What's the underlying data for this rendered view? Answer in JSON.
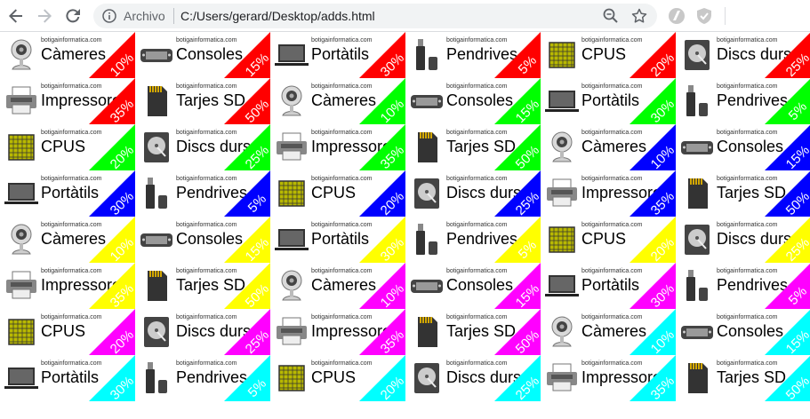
{
  "browser": {
    "secure_label": "Archivo",
    "url": "C:/Users/gerard/Desktop/adds.html"
  },
  "site": "botigainformatica.com",
  "icons": [
    "camera-icon",
    "gamepad-icon",
    "laptop-icon",
    "usb-drive-icon",
    "cpu-chip-icon",
    "hard-disk-icon",
    "printer-icon",
    "sd-card-icon"
  ],
  "colors": [
    "#ff0000",
    "#00ff00",
    "#0000ff",
    "#ffff00",
    "#ff00ff",
    "#00ffff"
  ],
  "ads": [
    {
      "name": "Càmeres",
      "discount": "10%",
      "icon": "camera-icon",
      "color": "#ff0000"
    },
    {
      "name": "Consoles",
      "discount": "15%",
      "icon": "gamepad-icon",
      "color": "#ff0000"
    },
    {
      "name": "Portàtils",
      "discount": "30%",
      "icon": "laptop-icon",
      "color": "#ff0000"
    },
    {
      "name": "Pendrives",
      "discount": "5%",
      "icon": "usb-drive-icon",
      "color": "#ff0000"
    },
    {
      "name": "CPUS",
      "discount": "20%",
      "icon": "cpu-chip-icon",
      "color": "#ff0000"
    },
    {
      "name": "Discs durs",
      "discount": "25%",
      "icon": "hard-disk-icon",
      "color": "#ff0000"
    },
    {
      "name": "Impressores",
      "discount": "35%",
      "icon": "printer-icon",
      "color": "#ff0000"
    },
    {
      "name": "Tarjes SD",
      "discount": "50%",
      "icon": "sd-card-icon",
      "color": "#ff0000"
    },
    {
      "name": "Càmeres",
      "discount": "10%",
      "icon": "camera-icon",
      "color": "#00ff00"
    },
    {
      "name": "Consoles",
      "discount": "15%",
      "icon": "gamepad-icon",
      "color": "#00ff00"
    },
    {
      "name": "Portàtils",
      "discount": "30%",
      "icon": "laptop-icon",
      "color": "#00ff00"
    },
    {
      "name": "Pendrives",
      "discount": "5%",
      "icon": "usb-drive-icon",
      "color": "#00ff00"
    },
    {
      "name": "CPUS",
      "discount": "20%",
      "icon": "cpu-chip-icon",
      "color": "#00ff00"
    },
    {
      "name": "Discs durs",
      "discount": "25%",
      "icon": "hard-disk-icon",
      "color": "#00ff00"
    },
    {
      "name": "Impressores",
      "discount": "35%",
      "icon": "printer-icon",
      "color": "#00ff00"
    },
    {
      "name": "Tarjes SD",
      "discount": "50%",
      "icon": "sd-card-icon",
      "color": "#00ff00"
    },
    {
      "name": "Càmeres",
      "discount": "10%",
      "icon": "camera-icon",
      "color": "#0000ff"
    },
    {
      "name": "Consoles",
      "discount": "15%",
      "icon": "gamepad-icon",
      "color": "#0000ff"
    },
    {
      "name": "Portàtils",
      "discount": "30%",
      "icon": "laptop-icon",
      "color": "#0000ff"
    },
    {
      "name": "Pendrives",
      "discount": "5%",
      "icon": "usb-drive-icon",
      "color": "#0000ff"
    },
    {
      "name": "CPUS",
      "discount": "20%",
      "icon": "cpu-chip-icon",
      "color": "#0000ff"
    },
    {
      "name": "Discs durs",
      "discount": "25%",
      "icon": "hard-disk-icon",
      "color": "#0000ff"
    },
    {
      "name": "Impressores",
      "discount": "35%",
      "icon": "printer-icon",
      "color": "#0000ff"
    },
    {
      "name": "Tarjes SD",
      "discount": "50%",
      "icon": "sd-card-icon",
      "color": "#0000ff"
    },
    {
      "name": "Càmeres",
      "discount": "10%",
      "icon": "camera-icon",
      "color": "#ffff00"
    },
    {
      "name": "Consoles",
      "discount": "15%",
      "icon": "gamepad-icon",
      "color": "#ffff00"
    },
    {
      "name": "Portàtils",
      "discount": "30%",
      "icon": "laptop-icon",
      "color": "#ffff00"
    },
    {
      "name": "Pendrives",
      "discount": "5%",
      "icon": "usb-drive-icon",
      "color": "#ffff00"
    },
    {
      "name": "CPUS",
      "discount": "20%",
      "icon": "cpu-chip-icon",
      "color": "#ffff00"
    },
    {
      "name": "Discs durs",
      "discount": "25%",
      "icon": "hard-disk-icon",
      "color": "#ffff00"
    },
    {
      "name": "Impressores",
      "discount": "35%",
      "icon": "printer-icon",
      "color": "#ffff00"
    },
    {
      "name": "Tarjes SD",
      "discount": "50%",
      "icon": "sd-card-icon",
      "color": "#ffff00"
    },
    {
      "name": "Càmeres",
      "discount": "10%",
      "icon": "camera-icon",
      "color": "#ff00ff"
    },
    {
      "name": "Consoles",
      "discount": "15%",
      "icon": "gamepad-icon",
      "color": "#ff00ff"
    },
    {
      "name": "Portàtils",
      "discount": "30%",
      "icon": "laptop-icon",
      "color": "#ff00ff"
    },
    {
      "name": "Pendrives",
      "discount": "5%",
      "icon": "usb-drive-icon",
      "color": "#ff00ff"
    },
    {
      "name": "CPUS",
      "discount": "20%",
      "icon": "cpu-chip-icon",
      "color": "#ff00ff"
    },
    {
      "name": "Discs durs",
      "discount": "25%",
      "icon": "hard-disk-icon",
      "color": "#ff00ff"
    },
    {
      "name": "Impressores",
      "discount": "35%",
      "icon": "printer-icon",
      "color": "#ff00ff"
    },
    {
      "name": "Tarjes SD",
      "discount": "50%",
      "icon": "sd-card-icon",
      "color": "#ff00ff"
    },
    {
      "name": "Càmeres",
      "discount": "10%",
      "icon": "camera-icon",
      "color": "#00ffff"
    },
    {
      "name": "Consoles",
      "discount": "15%",
      "icon": "gamepad-icon",
      "color": "#00ffff"
    },
    {
      "name": "Portàtils",
      "discount": "30%",
      "icon": "laptop-icon",
      "color": "#00ffff"
    },
    {
      "name": "Pendrives",
      "discount": "5%",
      "icon": "usb-drive-icon",
      "color": "#00ffff"
    },
    {
      "name": "CPUS",
      "discount": "20%",
      "icon": "cpu-chip-icon",
      "color": "#00ffff"
    },
    {
      "name": "Discs durs",
      "discount": "25%",
      "icon": "hard-disk-icon",
      "color": "#00ffff"
    },
    {
      "name": "Impressores",
      "discount": "35%",
      "icon": "printer-icon",
      "color": "#00ffff"
    },
    {
      "name": "Tarjes SD",
      "discount": "50%",
      "icon": "sd-card-icon",
      "color": "#00ffff"
    }
  ]
}
